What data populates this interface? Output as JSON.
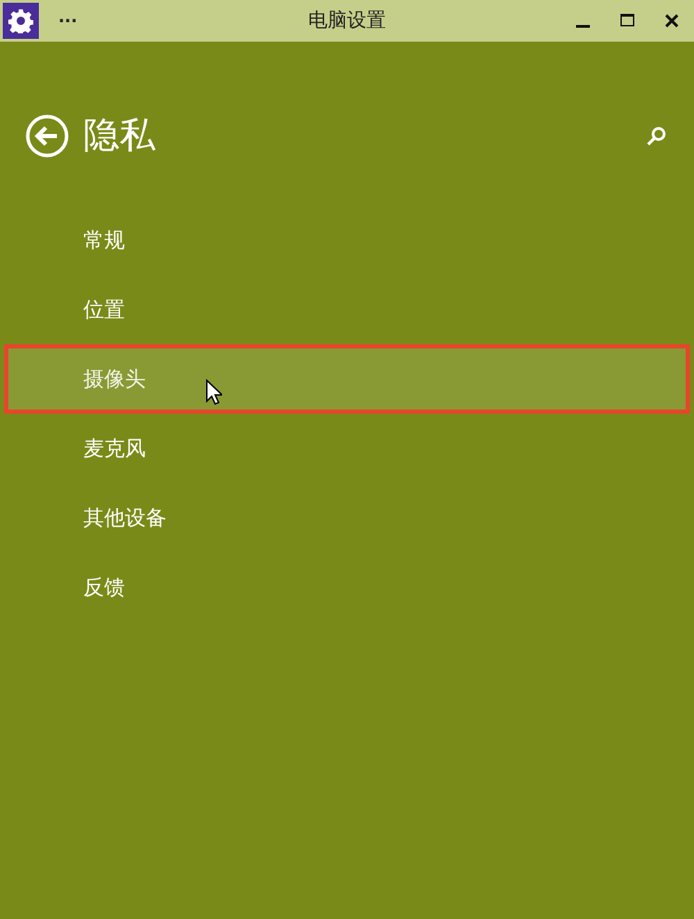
{
  "window": {
    "title": "电脑设置",
    "menu_glyph": "···"
  },
  "header": {
    "title": "隐私"
  },
  "items": [
    {
      "label": "常规",
      "selected": false
    },
    {
      "label": "位置",
      "selected": false
    },
    {
      "label": "摄像头",
      "selected": true
    },
    {
      "label": "麦克风",
      "selected": false
    },
    {
      "label": "其他设备",
      "selected": false
    },
    {
      "label": "反馈",
      "selected": false
    }
  ]
}
